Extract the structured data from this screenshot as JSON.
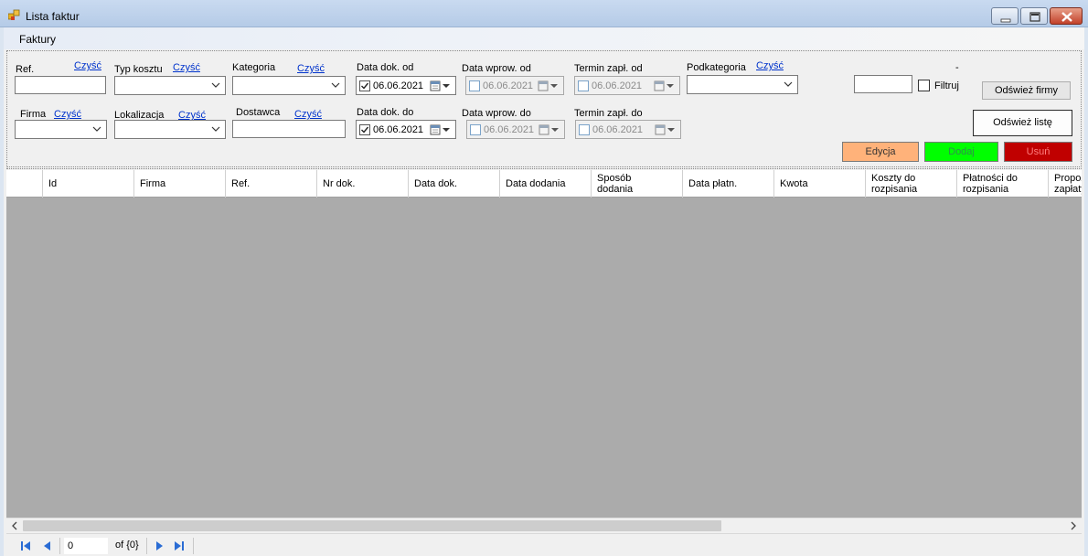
{
  "window": {
    "title": "Lista faktur"
  },
  "menu": {
    "items": [
      "Faktury"
    ]
  },
  "filters": {
    "clear_label": "Czyść",
    "ref_label": "Ref.",
    "firma_label": "Firma",
    "typ_kosztu_label": "Typ kosztu",
    "lokalizacja_label": "Lokalizacja",
    "kategoria_label": "Kategoria",
    "dostawca_label": "Dostawca",
    "data_dok_od_label": "Data dok. od",
    "data_dok_do_label": "Data dok. do",
    "data_wprow_od_label": "Data wprow. od",
    "data_wprow_do_label": "Data wprow. do",
    "termin_zapl_od_label": "Termin zapł. od",
    "termin_zapl_do_label": "Termin zapł. do",
    "podkategoria_label": "Podkategoria",
    "dash": "-",
    "date_value": "06.06.2021",
    "filtruj_label": "Filtruj",
    "odswiez_firmy": "Odśwież firmy",
    "odswiez_liste": "Odśwież listę"
  },
  "actions": {
    "edycja": "Edycja",
    "dodaj": "Dodaj",
    "usun": "Usuń"
  },
  "grid": {
    "columns": [
      "Id",
      "Firma",
      "Ref.",
      "Nr dok.",
      "Data dok.",
      "Data dodania",
      "Sposób\ndodania",
      "Data płatn.",
      "Kwota",
      "Koszty do\nrozpisania",
      "Płatności do\nrozpisania",
      "Propoz.\nzapłaty"
    ],
    "rows": []
  },
  "navigator": {
    "position": "0",
    "count": "of {0}"
  },
  "colors": {
    "edit": "#ffb27a",
    "add": "#00ff00",
    "delete": "#c00000",
    "grid_bg": "#ababab"
  }
}
